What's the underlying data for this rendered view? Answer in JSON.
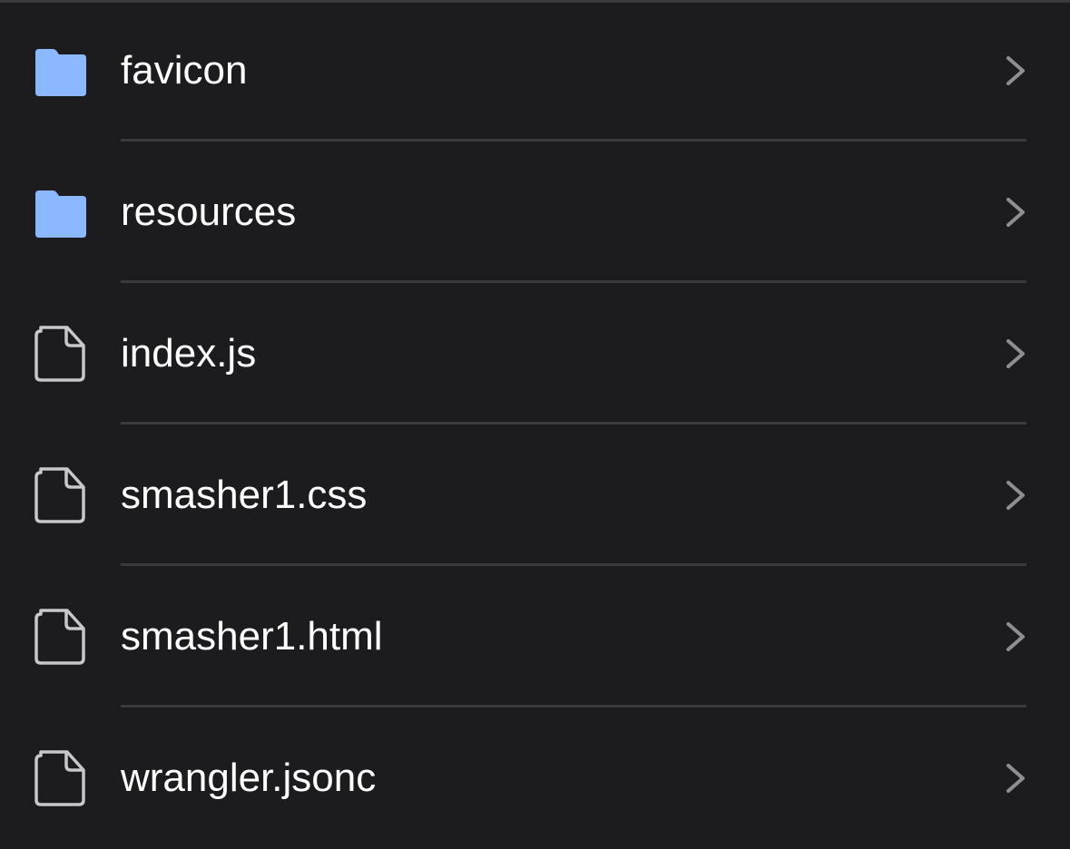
{
  "colors": {
    "background": "#1c1c1e",
    "folder_icon": "#8bb8ff",
    "file_icon_stroke": "#c7c7cc",
    "label": "#ffffff",
    "chevron": "#8e8e93",
    "divider": "#3a3a3c"
  },
  "files": [
    {
      "name": "favicon",
      "kind": "folder",
      "icon": "folder-icon"
    },
    {
      "name": "resources",
      "kind": "folder",
      "icon": "folder-icon"
    },
    {
      "name": "index.js",
      "kind": "file",
      "icon": "document-icon"
    },
    {
      "name": "smasher1.css",
      "kind": "file",
      "icon": "document-icon"
    },
    {
      "name": "smasher1.html",
      "kind": "file",
      "icon": "document-icon"
    },
    {
      "name": "wrangler.jsonc",
      "kind": "file",
      "icon": "document-icon"
    }
  ]
}
